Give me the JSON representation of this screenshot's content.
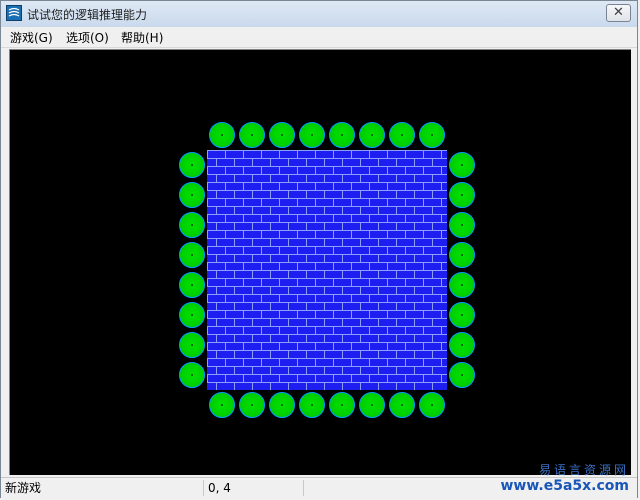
{
  "window": {
    "title": "试试您的逻辑推理能力",
    "close_label": "✕"
  },
  "menu": {
    "items": [
      {
        "label": "游戏(G)"
      },
      {
        "label": "选项(O)"
      },
      {
        "label": "帮助(H)"
      }
    ]
  },
  "board": {
    "top_count": 8,
    "bottom_count": 8,
    "left_count": 8,
    "right_count": 8,
    "colors": {
      "ball": "#00d000",
      "ball_outline": "#00a0ff",
      "brick": "#1e1ef0",
      "mortar": "#8aa0ff",
      "background": "#000000"
    }
  },
  "status": {
    "mode": "新游戏",
    "coords": "0, 4",
    "extra": ""
  },
  "watermark": {
    "line1": "易语言资源网",
    "line2": "www.e5a5x.com"
  }
}
